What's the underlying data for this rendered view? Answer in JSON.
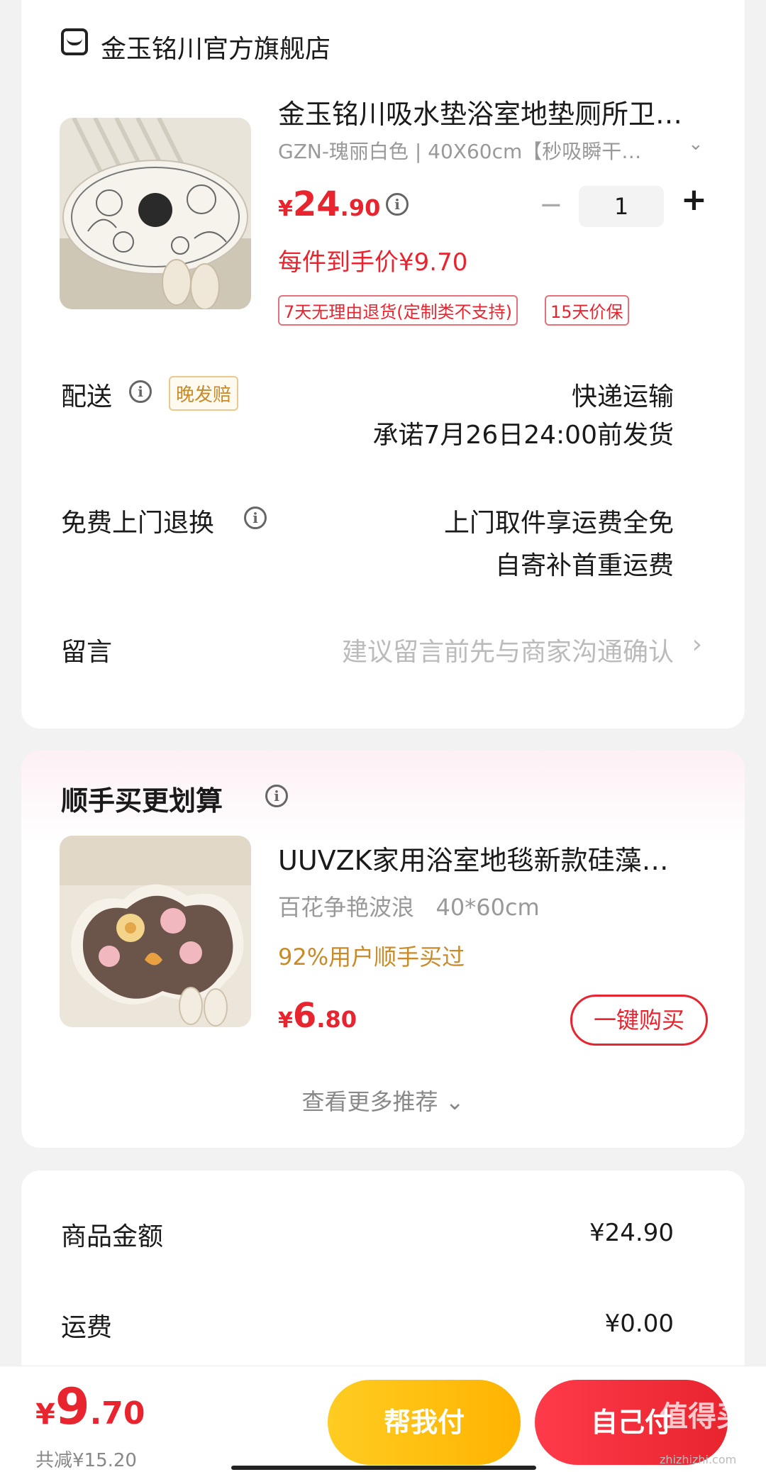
{
  "store": {
    "name": "金玉铭川官方旗舰店",
    "product": {
      "title": "金玉铭川吸水垫浴室地垫厕所卫…",
      "spec": "GZN-瑰丽白色 | 40X60cm【秒吸瞬干…",
      "price_yen": "¥",
      "price_int": "24",
      "price_dec": ".90",
      "quantity": "1",
      "quantity_minus": "−",
      "quantity_plus": "+",
      "unit_price_label": "每件到手价¥9.70",
      "tags": [
        "7天无理由退货(定制类不支持)",
        "15天价保"
      ]
    },
    "delivery": {
      "label": "配送",
      "badge": "晚发赔",
      "method": "快递运输",
      "promise": "承诺7月26日24:00前发货"
    },
    "returns": {
      "label": "免费上门退换",
      "line1": "上门取件享运费全免",
      "line2": "自寄补首重运费"
    },
    "message": {
      "label": "留言",
      "placeholder": "建议留言前先与商家沟通确认"
    }
  },
  "upsell": {
    "title": "顺手买更划算",
    "product": {
      "title": "UUVZK家用浴室地毯新款硅藻…",
      "spec": "百花争艳波浪   40*60cm",
      "stat": "92%用户顺手买过",
      "price_yen": "¥",
      "price_int": "6",
      "price_dec": ".80",
      "buy_label": "一键购买"
    },
    "more_label": "查看更多推荐"
  },
  "summary": {
    "goods_label": "商品金额",
    "goods_value": "¥24.90",
    "shipping_label": "运费",
    "shipping_value": "¥0.00"
  },
  "bottom": {
    "total_yen": "¥",
    "total_int": "9",
    "total_dec": ".70",
    "saved": "共减¥15.20",
    "help_pay": "帮我付",
    "self_pay": "自己付",
    "watermark": "值得买",
    "watermark_sub": "zhizhizhi.com"
  },
  "colors": {
    "accent_red": "#e8242f",
    "help_pay_yellow": "#ffc21a",
    "badge_orange": "#c98a2a"
  }
}
